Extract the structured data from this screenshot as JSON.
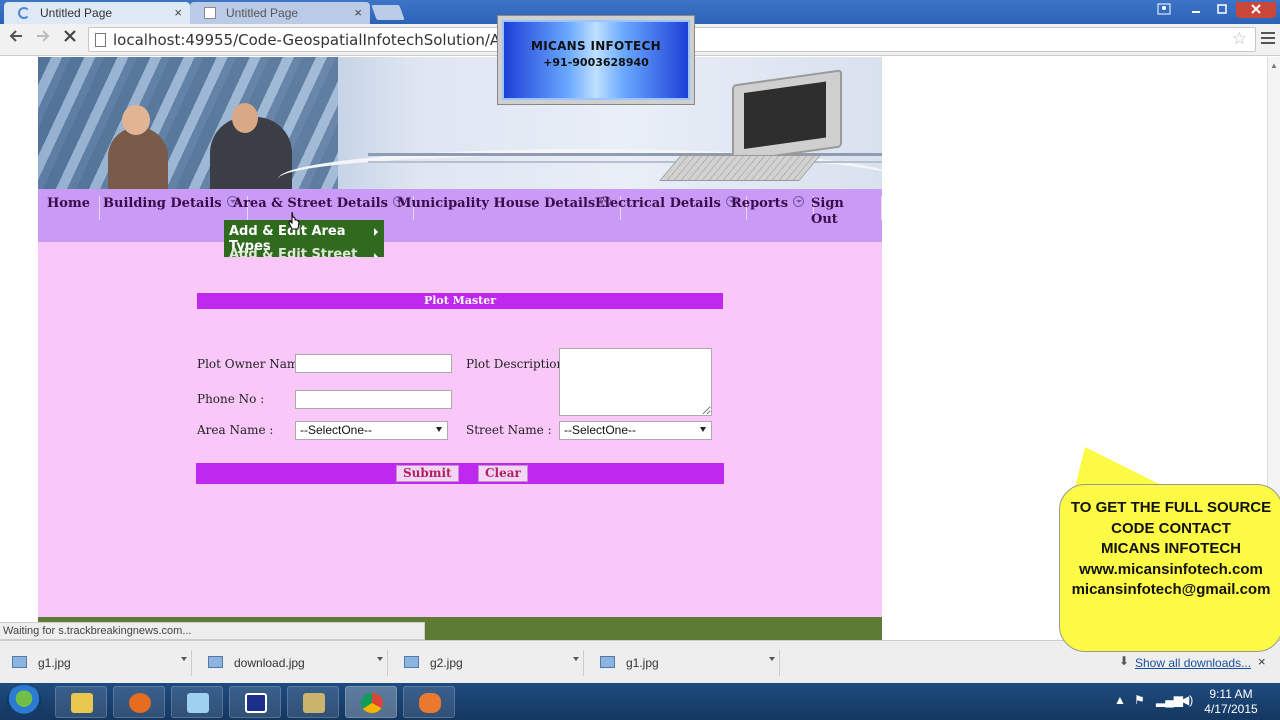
{
  "browser": {
    "tabs": [
      {
        "title": "Untitled Page",
        "active": true,
        "close": "×"
      },
      {
        "title": "Untitled Page",
        "active": false,
        "close": "×"
      }
    ],
    "url": "localhost:49955/Code-GeospatialInfotechSolution/Admin/",
    "status_text": "Waiting for s.trackbreakingnews.com..."
  },
  "watermark": {
    "company": "MICANS INFOTECH",
    "phone": "+91-9003628940"
  },
  "site": {
    "menu": [
      {
        "label": "Home",
        "has_dropdown": false
      },
      {
        "label": "Building Details",
        "has_dropdown": true
      },
      {
        "label": "Area & Street Details",
        "has_dropdown": true
      },
      {
        "label": "Municipality House Details",
        "has_dropdown": true
      },
      {
        "label": "Electrical Details",
        "has_dropdown": true
      },
      {
        "label": "Reports",
        "has_dropdown": true
      },
      {
        "label": "Sign Out",
        "has_dropdown": false
      }
    ],
    "submenu": [
      {
        "label": "Add & Edit Area Types"
      },
      {
        "label": "Add & Edit Street Types"
      }
    ],
    "form": {
      "title": "Plot Master",
      "plot_owner_label": "Plot Owner Name :",
      "plot_owner_value": "",
      "plot_description_label": "Plot Description :",
      "plot_description_value": "",
      "phone_label": "Phone No :",
      "phone_value": "",
      "area_label": "Area Name :",
      "area_selected": "--SelectOne--",
      "street_label": "Street Name :",
      "street_selected": "--SelectOne--",
      "submit_label": "Submit",
      "clear_label": "Clear"
    },
    "colors": {
      "page_bg": "#f9c8f9",
      "menu_bg": "#c99af6",
      "form_header": "#bf29ef",
      "submenu_bg": "#2f6a1e",
      "footer": "#5d7b35"
    }
  },
  "promo": {
    "lines": [
      "TO GET THE FULL SOURCE",
      "CODE CONTACT",
      "MICANS INFOTECH",
      "www.micansinfotech.com",
      "micansinfotech@gmail.com"
    ]
  },
  "downloads": {
    "items": [
      {
        "name": "g1.jpg"
      },
      {
        "name": "download.jpg"
      },
      {
        "name": "g2.jpg"
      },
      {
        "name": "g1.jpg"
      }
    ],
    "show_all": "Show all downloads...",
    "close": "×"
  },
  "taskbar": {
    "time": "9:11 AM",
    "date": "4/17/2015"
  }
}
